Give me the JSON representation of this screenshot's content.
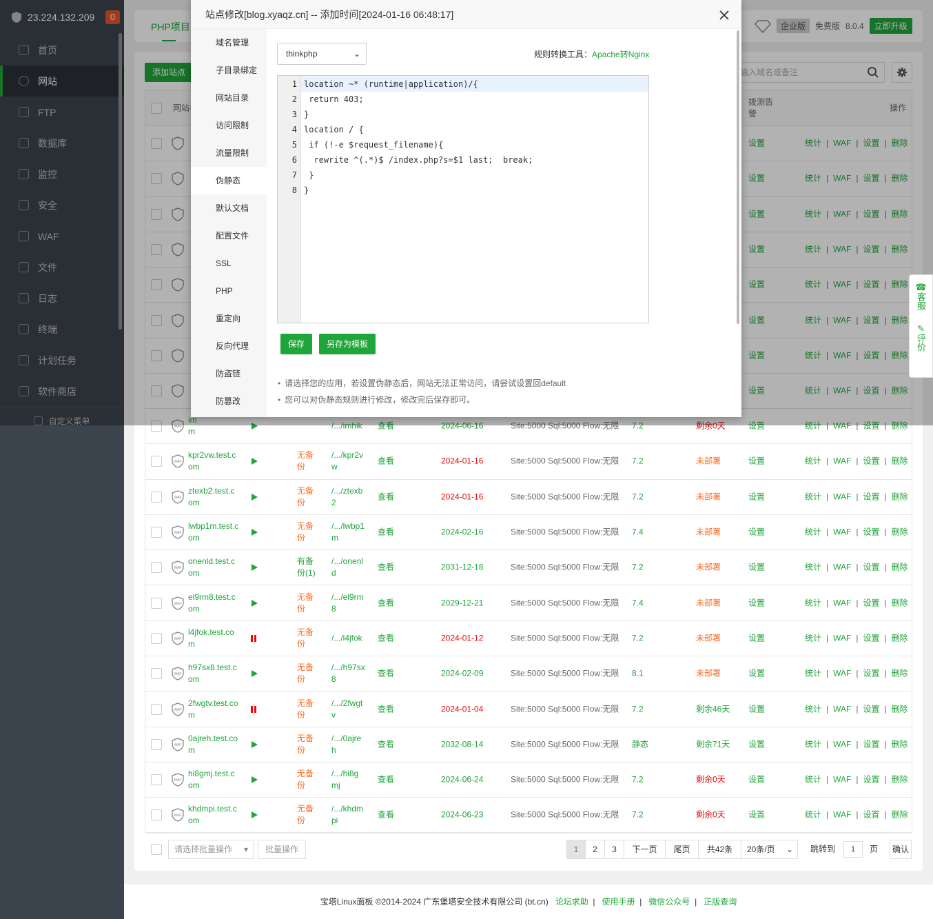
{
  "sidebar": {
    "ip": "23.224.132.209",
    "badge": "0",
    "items": [
      {
        "label": "首页",
        "icon": "home-icon"
      },
      {
        "label": "网站",
        "icon": "globe-icon",
        "active": true
      },
      {
        "label": "FTP",
        "icon": "ftp-icon"
      },
      {
        "label": "数据库",
        "icon": "database-icon"
      },
      {
        "label": "监控",
        "icon": "monitor-icon"
      },
      {
        "label": "安全",
        "icon": "shield-icon"
      },
      {
        "label": "WAF",
        "icon": "waf-icon"
      },
      {
        "label": "文件",
        "icon": "folder-icon"
      },
      {
        "label": "日志",
        "icon": "log-icon"
      },
      {
        "label": "终端",
        "icon": "terminal-icon"
      },
      {
        "label": "计划任务",
        "icon": "calendar-icon"
      },
      {
        "label": "软件商店",
        "icon": "apps-icon"
      }
    ],
    "custom_menu": "自定义菜单"
  },
  "header": {
    "tab": "PHP项目",
    "edition": "企业版",
    "free": "免费版",
    "version": "8.0.4",
    "upgrade": "立即升级"
  },
  "toolbar": {
    "add": "添加站点",
    "search_placeholder": "输入域名或备注"
  },
  "table": {
    "headers": {
      "name": "网站名",
      "dial": "拨测告警",
      "ops": "操作"
    },
    "rows": [
      {
        "name": [
          "im",
          "m"
        ],
        "status": "play",
        "backup": [
          "",
          ""
        ],
        "path": [
          "/.../imhik",
          ""
        ],
        "view": "查看",
        "date": "2024-06-16",
        "date_color": "green",
        "quota": "Site:5000 Sql:5000 Flow:无限",
        "php": "7.2",
        "ssl": "剩余0天",
        "ssl_color": "red"
      },
      {
        "name": [
          "kpr2vw.test.c",
          "om"
        ],
        "status": "play",
        "backup": [
          "无备",
          "份"
        ],
        "path": [
          "/.../kpr2v",
          "w"
        ],
        "view": "查看",
        "date": "2024-01-16",
        "date_color": "red",
        "quota": "Site:5000 Sql:5000 Flow:无限",
        "php": "7.2",
        "ssl": "未部署",
        "ssl_color": "orange"
      },
      {
        "name": [
          "ztexb2.test.c",
          "om"
        ],
        "status": "play",
        "backup": [
          "无备",
          "份"
        ],
        "path": [
          "/.../ztexb",
          "2"
        ],
        "view": "查看",
        "date": "2024-01-16",
        "date_color": "red",
        "quota": "Site:5000 Sql:5000 Flow:无限",
        "php": "7.2",
        "ssl": "未部署",
        "ssl_color": "orange"
      },
      {
        "name": [
          "lwbp1m.test.c",
          "om"
        ],
        "status": "play",
        "backup": [
          "无备",
          "份"
        ],
        "path": [
          "/.../lwbp1",
          "m"
        ],
        "view": "查看",
        "date": "2024-02-16",
        "date_color": "green",
        "quota": "Site:5000 Sql:5000 Flow:无限",
        "php": "7.4",
        "ssl": "未部署",
        "ssl_color": "orange"
      },
      {
        "name": [
          "onenld.test.c",
          "om"
        ],
        "status": "play",
        "backup": [
          "有备",
          "份(1)"
        ],
        "backup_color": "green",
        "path": [
          "/.../onenl",
          "d"
        ],
        "view": "查看",
        "date": "2031-12-18",
        "date_color": "green",
        "quota": "Site:5000 Sql:5000 Flow:无限",
        "php": "7.2",
        "ssl": "未部署",
        "ssl_color": "orange"
      },
      {
        "name": [
          "el9rm8.test.c",
          "om"
        ],
        "status": "play",
        "backup": [
          "无备",
          "份"
        ],
        "path": [
          "/.../el9rm",
          "8"
        ],
        "view": "查看",
        "date": "2029-12-21",
        "date_color": "green",
        "quota": "Site:5000 Sql:5000 Flow:无限",
        "php": "7.4",
        "ssl": "未部署",
        "ssl_color": "orange"
      },
      {
        "name": [
          "l4jfok.test.co",
          "m"
        ],
        "status": "pause",
        "backup": [
          "无备",
          "份"
        ],
        "path": [
          "/.../l4jfok",
          ""
        ],
        "view": "查看",
        "date": "2024-01-12",
        "date_color": "red",
        "quota": "Site:5000 Sql:5000 Flow:无限",
        "php": "7.2",
        "ssl": "未部署",
        "ssl_color": "orange"
      },
      {
        "name": [
          "h97sx8.test.c",
          "om"
        ],
        "status": "play",
        "backup": [
          "无备",
          "份"
        ],
        "path": [
          "/.../h97sx",
          "8"
        ],
        "view": "查看",
        "date": "2024-02-09",
        "date_color": "green",
        "quota": "Site:5000 Sql:5000 Flow:无限",
        "php": "8.1",
        "ssl": "未部署",
        "ssl_color": "orange"
      },
      {
        "name": [
          "2fwgtv.test.co",
          "m"
        ],
        "status": "pause",
        "backup": [
          "无备",
          "份"
        ],
        "path": [
          "/.../2fwgt",
          "v"
        ],
        "view": "查看",
        "date": "2024-01-04",
        "date_color": "red",
        "quota": "Site:5000 Sql:5000 Flow:无限",
        "php": "7.2",
        "ssl": "剩余46天",
        "ssl_color": "green"
      },
      {
        "name": [
          "0ajreh.test.co",
          "m"
        ],
        "status": "play",
        "backup": [
          "无备",
          "份"
        ],
        "path": [
          "/.../0ajre",
          "h"
        ],
        "view": "查看",
        "date": "2032-08-14",
        "date_color": "green",
        "quota": "Site:5000 Sql:5000 Flow:无限",
        "php": "静态",
        "ssl": "剩余71天",
        "ssl_color": "green"
      },
      {
        "name": [
          "hi8gmj.test.c",
          "om"
        ],
        "status": "play",
        "backup": [
          "无备",
          "份"
        ],
        "path": [
          "/.../hi8g",
          "mj"
        ],
        "view": "查看",
        "date": "2024-06-24",
        "date_color": "green",
        "quota": "Site:5000 Sql:5000 Flow:无限",
        "php": "7.2",
        "ssl": "剩余0天",
        "ssl_color": "red"
      },
      {
        "name": [
          "khdmpi.test.c",
          "om"
        ],
        "status": "play",
        "backup": [
          "无备",
          "份"
        ],
        "path": [
          "/.../khdm",
          "pi"
        ],
        "view": "查看",
        "date": "2024-06-23",
        "date_color": "green",
        "quota": "Site:5000 Sql:5000 Flow:无限",
        "php": "7.2",
        "ssl": "剩余0天",
        "ssl_color": "red"
      }
    ],
    "dial_label": "设置",
    "ops": [
      "统计",
      "WAF",
      "设置",
      "删除"
    ]
  },
  "pager": {
    "batch_placeholder": "请选择批量操作",
    "batch_btn": "批量操作",
    "pages": [
      "1",
      "2",
      "3"
    ],
    "next": "下一页",
    "last": "尾页",
    "total": "共42条",
    "per_page": "20条/页",
    "jump_label": "跳转到",
    "jump_value": "1",
    "page_unit": "页",
    "confirm": "确认"
  },
  "footer": {
    "copyright": "宝塔Linux面板 ©2014-2024 广东堡塔安全技术有限公司 (bt.cn)",
    "links": [
      "论坛求助",
      "使用手册",
      "微信公众号",
      "正版查询"
    ]
  },
  "float_panel": {
    "service": "客服",
    "review": "评价"
  },
  "modal": {
    "title": "站点修改[blog.xyaqz.cn] -- 添加时间[2024-01-16 06:48:17]",
    "nav": [
      "域名管理",
      "子目录绑定",
      "网站目录",
      "访问限制",
      "流量限制",
      "伪静态",
      "默认文档",
      "配置文件",
      "SSL",
      "PHP",
      "重定向",
      "反向代理",
      "防盗链",
      "防篡改"
    ],
    "active_nav": "伪静态",
    "template_select": "thinkphp",
    "convert_label": "规则转换工具：",
    "convert_link": "Apache转Nginx",
    "code_lines": [
      "location ~* (runtime|application)/{",
      " return 403;",
      "}",
      "location / {",
      " if (!-e $request_filename){",
      "  rewrite ^(.*)$ /index.php?s=$1 last;  break;",
      " }",
      "}"
    ],
    "save": "保存",
    "save_template": "另存为模板",
    "tips": [
      "请选择您的应用，若设置伪静态后，网站无法正常访问，请尝试设置回default",
      "您可以对伪静态规则进行修改，修改完后保存即可。"
    ]
  },
  "colors": {
    "accent": "#20a53a",
    "danger": "#ef0808",
    "warning": "#fc6d26",
    "sidebar": "#3c444d"
  }
}
